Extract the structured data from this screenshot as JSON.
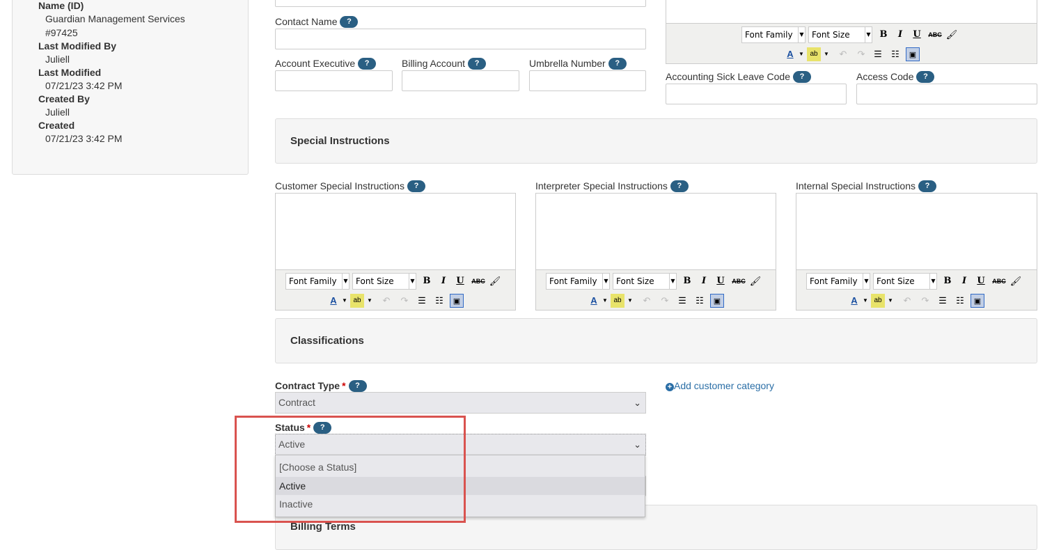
{
  "meta": {
    "name_label": "Name (ID)",
    "name_value": "Guardian Management Services",
    "id_value": "#97425",
    "last_modified_by_label": "Last Modified By",
    "last_modified_by_value": "Juliell",
    "last_modified_label": "Last Modified",
    "last_modified_value": "07/21/23 3:42 PM",
    "created_by_label": "Created By",
    "created_by_value": "Juliell",
    "created_label": "Created",
    "created_value": "07/21/23 3:42 PM"
  },
  "help_glyph": "?",
  "required_glyph": "*",
  "form": {
    "contact_name_label": "Contact Name",
    "account_executive_label": "Account Executive",
    "billing_account_label": "Billing Account",
    "umbrella_number_label": "Umbrella Number",
    "accounting_sick_leave_label": "Accounting Sick Leave Code",
    "access_code_label": "Access Code"
  },
  "editor_toolbar": {
    "font_family": "Font Family",
    "font_size": "Font Size",
    "bold": "B",
    "italic": "I",
    "underline": "U",
    "strike": "ABC"
  },
  "special_instructions": {
    "title": "Special Instructions",
    "customer_label": "Customer Special Instructions",
    "interpreter_label": "Interpreter Special Instructions",
    "internal_label": "Internal Special Instructions"
  },
  "classifications": {
    "title": "Classifications",
    "contract_type_label": "Contract Type",
    "contract_type_value": "Contract",
    "add_category_link": "Add customer category",
    "status_label": "Status",
    "status_value": "Active",
    "status_options": [
      "[Choose a Status]",
      "Active",
      "Inactive"
    ]
  },
  "billing_terms": {
    "title": "Billing Terms"
  },
  "colors": {
    "help_badge": "#2a5f83",
    "highlight": "#d9534f",
    "link": "#2a6ea6"
  }
}
